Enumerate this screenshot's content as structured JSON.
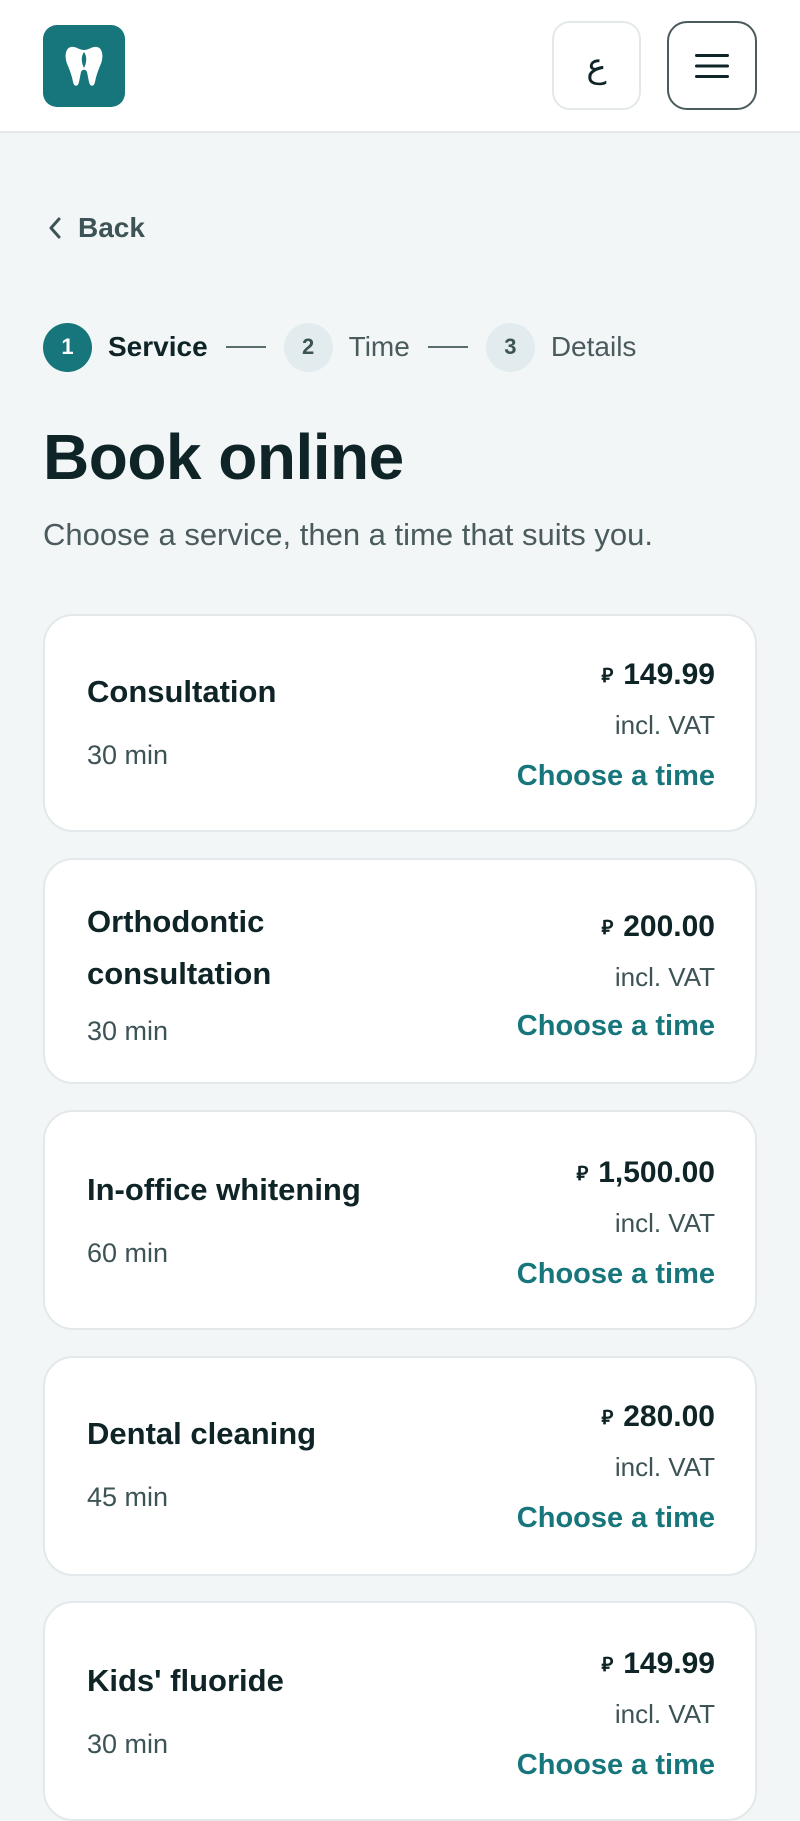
{
  "header": {
    "logo_icon": "tooth-icon",
    "language_label": "ع",
    "menu_icon": "hamburger-icon"
  },
  "nav": {
    "back_label": "Back"
  },
  "steps": [
    {
      "number": "1",
      "label": "Service"
    },
    {
      "number": "2",
      "label": "Time"
    },
    {
      "number": "3",
      "label": "Details"
    }
  ],
  "page": {
    "title": "Book online",
    "subtitle": "Choose a service, then a time that suits you."
  },
  "services": [
    {
      "name": "Consultation",
      "duration": "30 min",
      "currency": "⃁",
      "price": "149.99",
      "vat": "incl. VAT",
      "action": "Choose a time"
    },
    {
      "name": "Orthodontic consultation",
      "duration": "30 min",
      "currency": "⃁",
      "price": "200.00",
      "vat": "incl. VAT",
      "action": "Choose a time"
    },
    {
      "name": "In-office whitening",
      "duration": "60 min",
      "currency": "⃁",
      "price": "1,500.00",
      "vat": "incl. VAT",
      "action": "Choose a time"
    },
    {
      "name": "Dental cleaning",
      "duration": "45 min",
      "currency": "⃁",
      "price": "280.00",
      "vat": "incl. VAT",
      "action": "Choose a time"
    },
    {
      "name": "Kids' fluoride",
      "duration": "30 min",
      "currency": "⃁",
      "price": "149.99",
      "vat": "incl. VAT",
      "action": "Choose a time"
    }
  ],
  "colors": {
    "brand": "#16767b",
    "background": "#f2f6f7",
    "text": "#0f2426"
  }
}
